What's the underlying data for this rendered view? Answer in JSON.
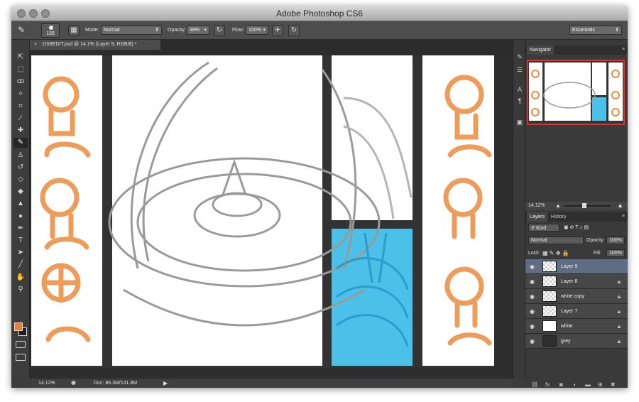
{
  "window": {
    "title": "Adobe Photoshop CS6"
  },
  "options_bar": {
    "brush_size": "136",
    "mode_label": "Mode:",
    "mode_value": "Normal",
    "opacity_label": "Opacity:",
    "opacity_value": "39%",
    "flow_label": "Flow:",
    "flow_value": "100%",
    "workspace": "Essentials"
  },
  "document": {
    "tab_title": "DS9EDIT.psd @ 14.1% (Layer 9, RGB/8) *",
    "close_glyph": "×"
  },
  "tools": [
    {
      "name": "move-tool",
      "glyph": "⇱"
    },
    {
      "name": "marquee-tool",
      "glyph": "⬚"
    },
    {
      "name": "lasso-tool",
      "glyph": "ꝏ"
    },
    {
      "name": "quick-select-tool",
      "glyph": "✧"
    },
    {
      "name": "crop-tool",
      "glyph": "⌗"
    },
    {
      "name": "eyedropper-tool",
      "glyph": "⁄"
    },
    {
      "name": "healing-tool",
      "glyph": "✚"
    },
    {
      "name": "brush-tool",
      "glyph": "✎"
    },
    {
      "name": "stamp-tool",
      "glyph": "♙"
    },
    {
      "name": "history-brush-tool",
      "glyph": "↺"
    },
    {
      "name": "eraser-tool",
      "glyph": "◇"
    },
    {
      "name": "bucket-tool",
      "glyph": "◆"
    },
    {
      "name": "blur-tool",
      "glyph": "▲"
    },
    {
      "name": "dodge-tool",
      "glyph": "●"
    },
    {
      "name": "pen-tool",
      "glyph": "✒"
    },
    {
      "name": "type-tool",
      "glyph": "T"
    },
    {
      "name": "path-select-tool",
      "glyph": "➤"
    },
    {
      "name": "line-tool",
      "glyph": "╱"
    },
    {
      "name": "hand-tool",
      "glyph": "✋"
    },
    {
      "name": "zoom-tool",
      "glyph": "⚲"
    }
  ],
  "colors": {
    "foreground": "#e8823a",
    "background": "#1e1e1e",
    "layer_selected": "#5e6c84",
    "sketch_orange": "#ec8b3e",
    "sketch_blue": "#4bc0e8"
  },
  "navigator": {
    "tab": "Navigator",
    "zoom": "14.12%"
  },
  "layers_panel": {
    "tabs": [
      "Layers",
      "History"
    ],
    "kind_label": "Kind",
    "blend_mode": "Normal",
    "opacity_label": "Opacity:",
    "opacity_value": "100%",
    "lock_label": "Lock:",
    "fill_label": "Fill:",
    "fill_value": "100%",
    "layers": [
      {
        "name": "Layer 9",
        "thumb": "check",
        "selected": true,
        "locked": false
      },
      {
        "name": "Layer 8",
        "thumb": "check",
        "selected": false,
        "locked": true
      },
      {
        "name": "white copy",
        "thumb": "check",
        "selected": false,
        "locked": true
      },
      {
        "name": "Layer 7",
        "thumb": "check",
        "selected": false,
        "locked": true
      },
      {
        "name": "white",
        "thumb": "white",
        "selected": false,
        "locked": true
      },
      {
        "name": "grey",
        "thumb": "grey",
        "selected": false,
        "locked": true
      }
    ]
  },
  "status_bar": {
    "zoom": "14.12%",
    "doc_info": "Doc: 86.3M/141.8M"
  }
}
